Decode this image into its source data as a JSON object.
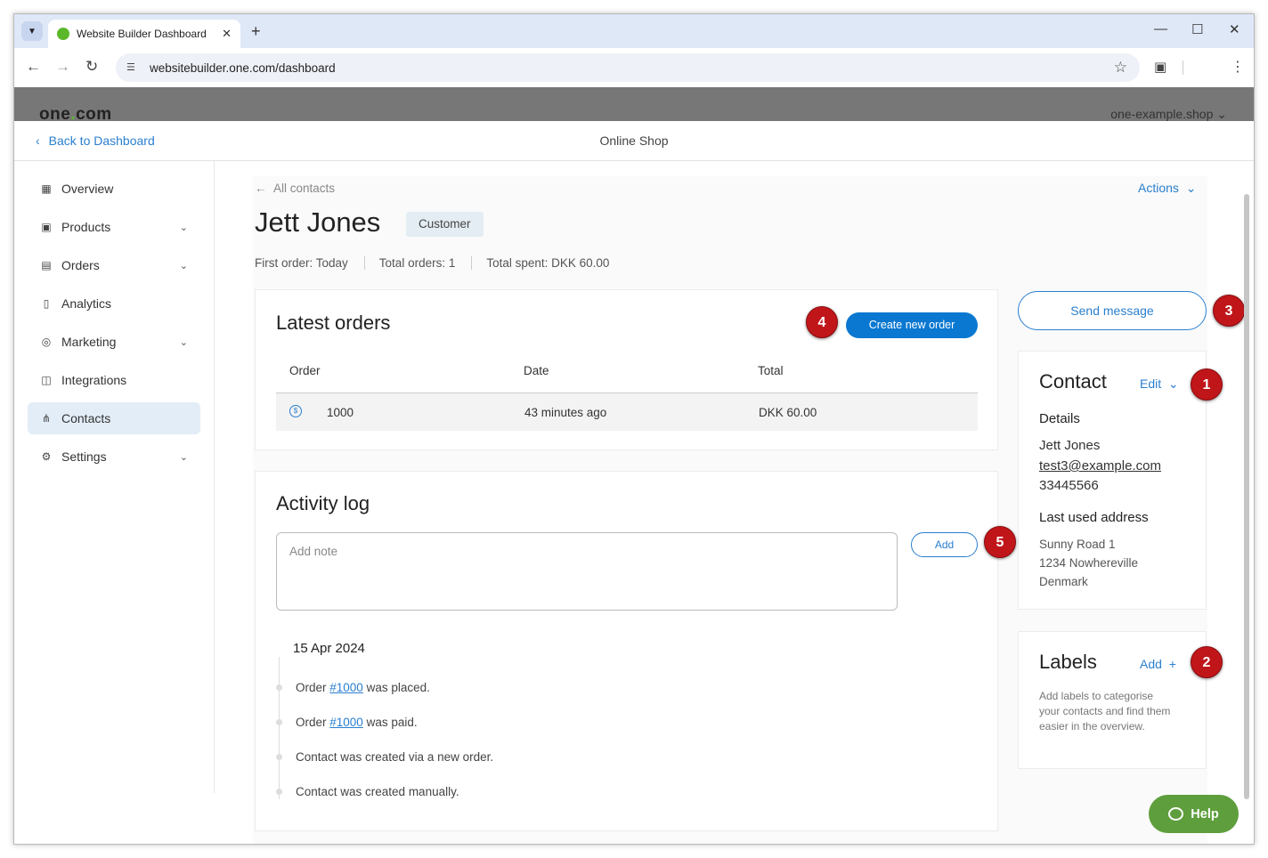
{
  "browser": {
    "tab_title": "Website Builder Dashboard",
    "url": "websitebuilder.one.com/dashboard"
  },
  "brand": {
    "logo_text_a": "one",
    "logo_dot": ".",
    "logo_text_b": "com",
    "domain": "one-example.shop"
  },
  "subheader": {
    "back_label": "Back to Dashboard",
    "section_title": "Online Shop"
  },
  "sidebar": {
    "items": [
      {
        "label": "Overview",
        "icon": "grid-icon"
      },
      {
        "label": "Products",
        "icon": "products-icon"
      },
      {
        "label": "Orders",
        "icon": "orders-icon"
      },
      {
        "label": "Analytics",
        "icon": "analytics-icon"
      },
      {
        "label": "Marketing",
        "icon": "marketing-icon"
      },
      {
        "label": "Integrations",
        "icon": "integrations-icon"
      },
      {
        "label": "Contacts",
        "icon": "contacts-icon"
      },
      {
        "label": "Settings",
        "icon": "settings-icon"
      }
    ]
  },
  "contact": {
    "back_label": "All contacts",
    "actions_label": "Actions",
    "name": "Jett Jones",
    "badge": "Customer",
    "stats": {
      "first_order": "First order: Today",
      "total_orders": "Total orders: 1",
      "total_spent": "Total spent: DKK 60.00"
    }
  },
  "latest_orders": {
    "title": "Latest orders",
    "create_label": "Create new order",
    "columns": [
      "Order",
      "Date",
      "Total"
    ],
    "rows": [
      {
        "order": "1000",
        "date": "43 minutes ago",
        "total": "DKK 60.00"
      }
    ]
  },
  "activity": {
    "title": "Activity log",
    "note_placeholder": "Add note",
    "add_label": "Add",
    "date": "15 Apr 2024",
    "entries": [
      {
        "prefix": "Order ",
        "link": "#1000",
        "suffix": " was placed."
      },
      {
        "prefix": "Order ",
        "link": "#1000",
        "suffix": " was paid."
      },
      {
        "prefix": "Contact was created via a new order.",
        "link": "",
        "suffix": ""
      },
      {
        "prefix": "Contact was created manually.",
        "link": "",
        "suffix": ""
      }
    ]
  },
  "contact_panel": {
    "send_label": "Send message",
    "title": "Contact",
    "edit_label": "Edit",
    "details_heading": "Details",
    "name": "Jett Jones",
    "email": "test3@example.com",
    "phone": "33445566",
    "address_heading": "Last used address",
    "address_line1": "Sunny Road 1",
    "address_line2": "1234 Nowhereville",
    "address_line3": "Denmark"
  },
  "labels_panel": {
    "title": "Labels",
    "add_label": "Add",
    "description": "Add labels to categorise your contacts and find them easier in the overview."
  },
  "markers": [
    "1",
    "2",
    "3",
    "4",
    "5"
  ],
  "help_label": "Help",
  "colors": {
    "accent": "#2a7fcf",
    "primary_button": "#0a78d1",
    "marker": "#c0161a",
    "help": "#5e9e3c",
    "brand_green": "#5cb82b"
  }
}
